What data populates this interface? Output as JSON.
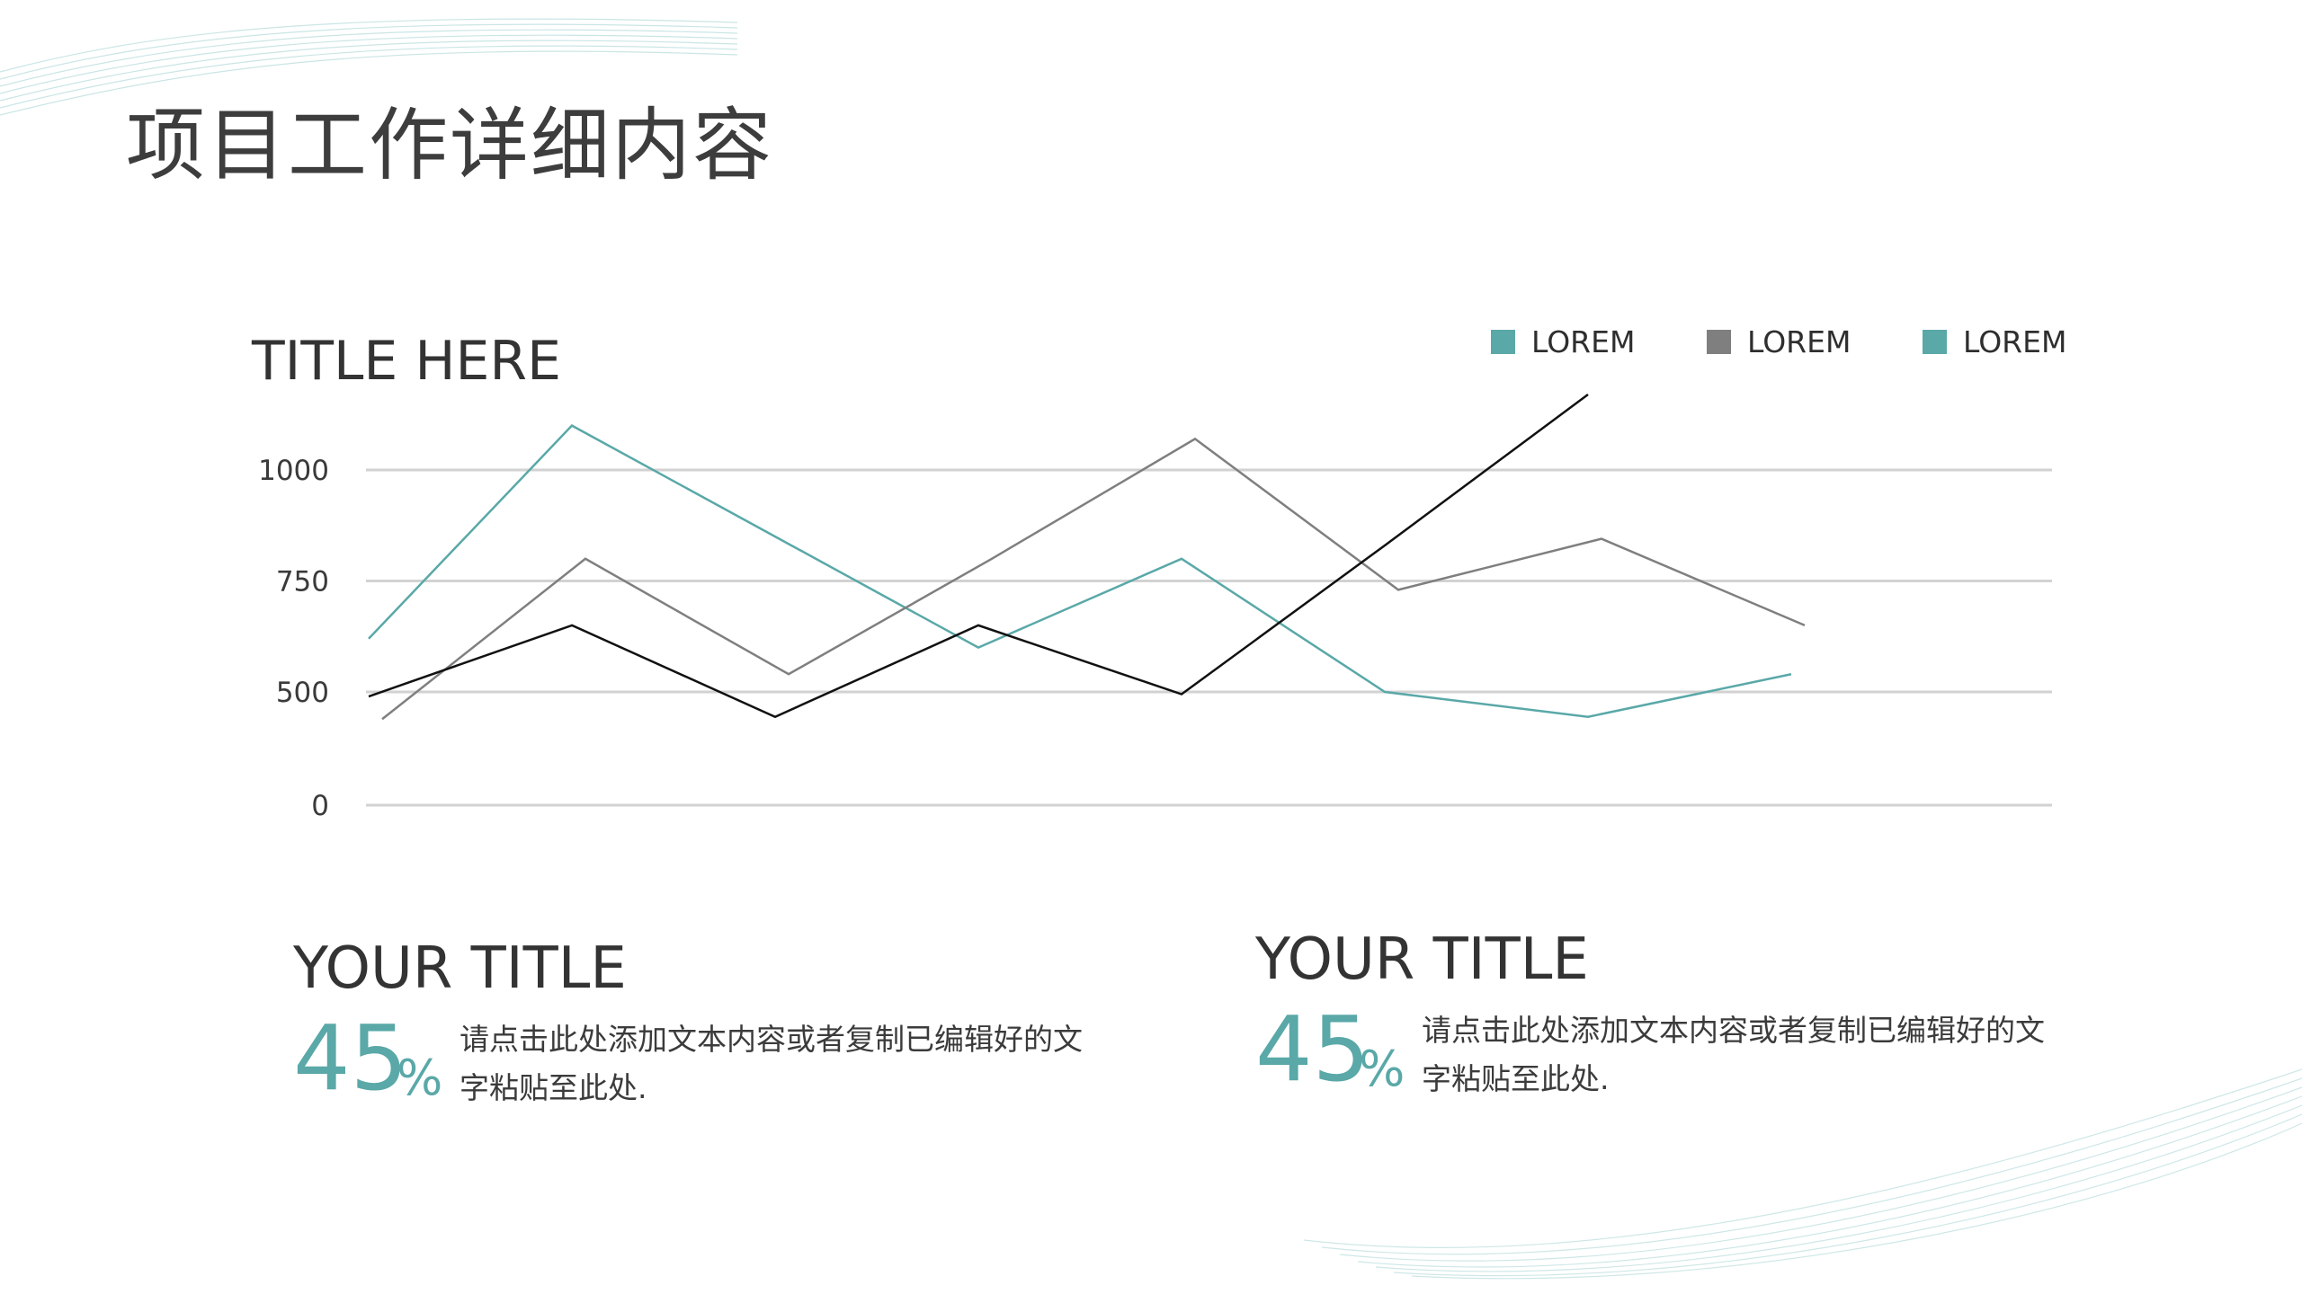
{
  "slide": {
    "title": "项目工作详细内容"
  },
  "chart_data": {
    "type": "line",
    "title": "TITLE HERE",
    "xlabel": "",
    "ylabel": "",
    "y_ticks": [
      "1000",
      "750",
      "500",
      "0"
    ],
    "ylim": [
      0,
      1000
    ],
    "grid": true,
    "legend_position": "top-right",
    "legend": [
      {
        "label": "LOREM",
        "color": "#5aa8a8"
      },
      {
        "label": "LOREM",
        "color": "#7f7f7f"
      },
      {
        "label": "LOREM",
        "color": "#5aa8a8"
      }
    ],
    "series": [
      {
        "color": "#5aa8a8",
        "points": [
          [
            0,
            620
          ],
          [
            1,
            1100
          ],
          [
            2,
            850
          ],
          [
            3,
            600
          ],
          [
            4,
            800
          ],
          [
            5,
            500
          ],
          [
            6,
            390
          ],
          [
            7,
            540
          ]
        ]
      },
      {
        "color": "#7f7f7f",
        "points": [
          [
            0,
            380
          ],
          [
            1,
            800
          ],
          [
            2,
            540
          ],
          [
            3,
            800
          ],
          [
            4,
            1070
          ],
          [
            5,
            730
          ],
          [
            6,
            845
          ],
          [
            7,
            650
          ]
        ]
      },
      {
        "color": "#111111",
        "points": [
          [
            0,
            480
          ],
          [
            1,
            650
          ],
          [
            2,
            390
          ],
          [
            3,
            650
          ],
          [
            4,
            490
          ],
          [
            5,
            830
          ],
          [
            6,
            1170
          ]
        ]
      }
    ]
  },
  "stats": [
    {
      "title": "YOUR TITLE",
      "value": "45",
      "unit": "%",
      "description": "请点击此处添加文本内容或者复制已编辑好的文字粘贴至此处."
    },
    {
      "title": "YOUR TITLE",
      "value": "45",
      "unit": "%",
      "description": "请点击此处添加文本内容或者复制已编辑好的文字粘贴至此处."
    }
  ]
}
